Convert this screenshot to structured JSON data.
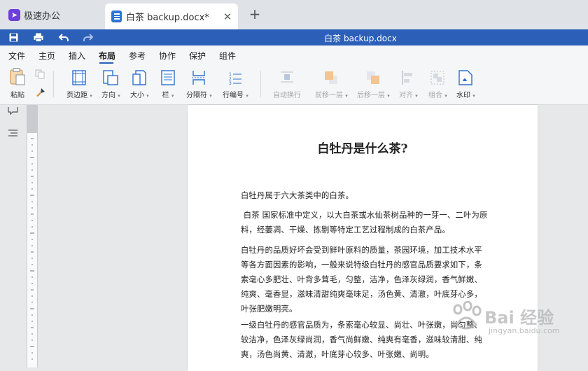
{
  "app": {
    "title": "极速办公"
  },
  "tab": {
    "title": "白茶 backup.docx*"
  },
  "quickbar": {
    "doc_title": "白茶 backup.docx"
  },
  "menu": [
    "文件",
    "主页",
    "插入",
    "布局",
    "参考",
    "协作",
    "保护",
    "组件"
  ],
  "ribbon": {
    "paste": "粘贴",
    "margins": "页边距",
    "orientation": "方向",
    "size": "大小",
    "columns": "栏",
    "breaks": "分隔符",
    "line_numbers": "行编号",
    "wrap": "自动换行",
    "bring_forward": "前移一层",
    "send_backward": "后移一层",
    "align": "对齐",
    "group": "组合",
    "watermark": "水印"
  },
  "document": {
    "title": "白牡丹是什么茶?",
    "p1": "白牡丹属于六大茶类中的白茶。",
    "p2": " 白茶 国家标准中定义，以大白茶或水仙茶树品种的一芽一、二叶为原料，经萎凋、干燥、拣剔等特定工艺过程制成的白茶产品。",
    "p3": "白牡丹的品质好坏会受到鲜叶原料的质量，茶园环境，加工技术水平等各方面因素的影响，一般来说特级白牡丹的感官品质要求如下，条索毫心多肥壮、叶背多茸毛，匀整，洁净，色泽灰绿润，香气鲜嫩、纯爽、毫香显，滋味清甜纯爽毫味足，汤色黄、清澈，叶底芽心多，叶张肥嫩明亮。",
    "p4": "一级白牡丹的感官品质为，条索毫心较显、尚壮、叶张嫩，尚匀整、较洁净，色泽灰绿尚润，香气尚鲜嫩、纯爽有毫香，滋味较清甜、纯爽，汤色尚黄、清澈，叶底芽心较多、叶张嫩、尚明。"
  },
  "watermark": {
    "text": "Bai 经验",
    "url": "jingyan.baidu.com"
  }
}
